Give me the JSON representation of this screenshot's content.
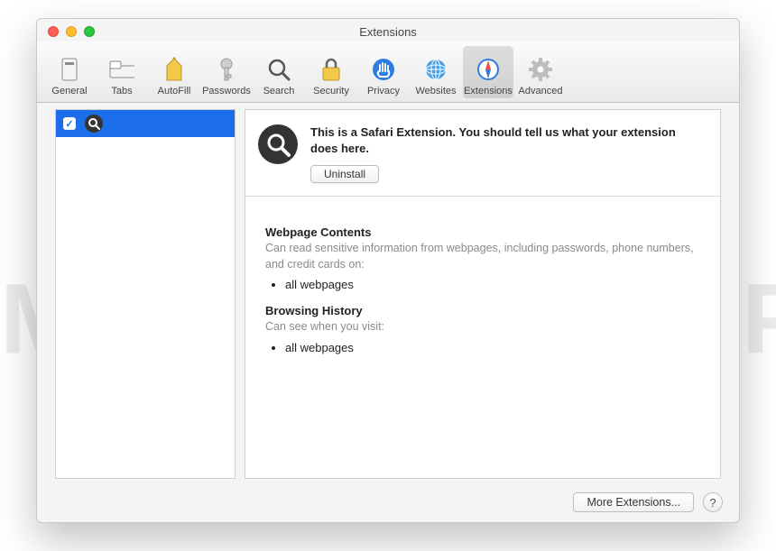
{
  "window": {
    "title": "Extensions"
  },
  "toolbar": {
    "items": [
      {
        "label": "General"
      },
      {
        "label": "Tabs"
      },
      {
        "label": "AutoFill"
      },
      {
        "label": "Passwords"
      },
      {
        "label": "Search"
      },
      {
        "label": "Security"
      },
      {
        "label": "Privacy"
      },
      {
        "label": "Websites"
      },
      {
        "label": "Extensions"
      },
      {
        "label": "Advanced"
      }
    ],
    "selected_index": 8
  },
  "sidebar": {
    "items": [
      {
        "checked": true,
        "name": ""
      }
    ]
  },
  "detail": {
    "description": "This is a Safari Extension. You should tell us what your extension does here.",
    "uninstall_label": "Uninstall",
    "permissions": {
      "webpage_contents": {
        "heading": "Webpage Contents",
        "subtext": "Can read sensitive information from webpages, including passwords, phone numbers, and credit cards on:",
        "bullets_0": "all webpages"
      },
      "browsing_history": {
        "heading": "Browsing History",
        "subtext": "Can see when you visit:",
        "bullets_0": "all webpages"
      }
    }
  },
  "footer": {
    "more_label": "More Extensions...",
    "help_label": "?"
  },
  "watermark": "MALWARETIPS"
}
